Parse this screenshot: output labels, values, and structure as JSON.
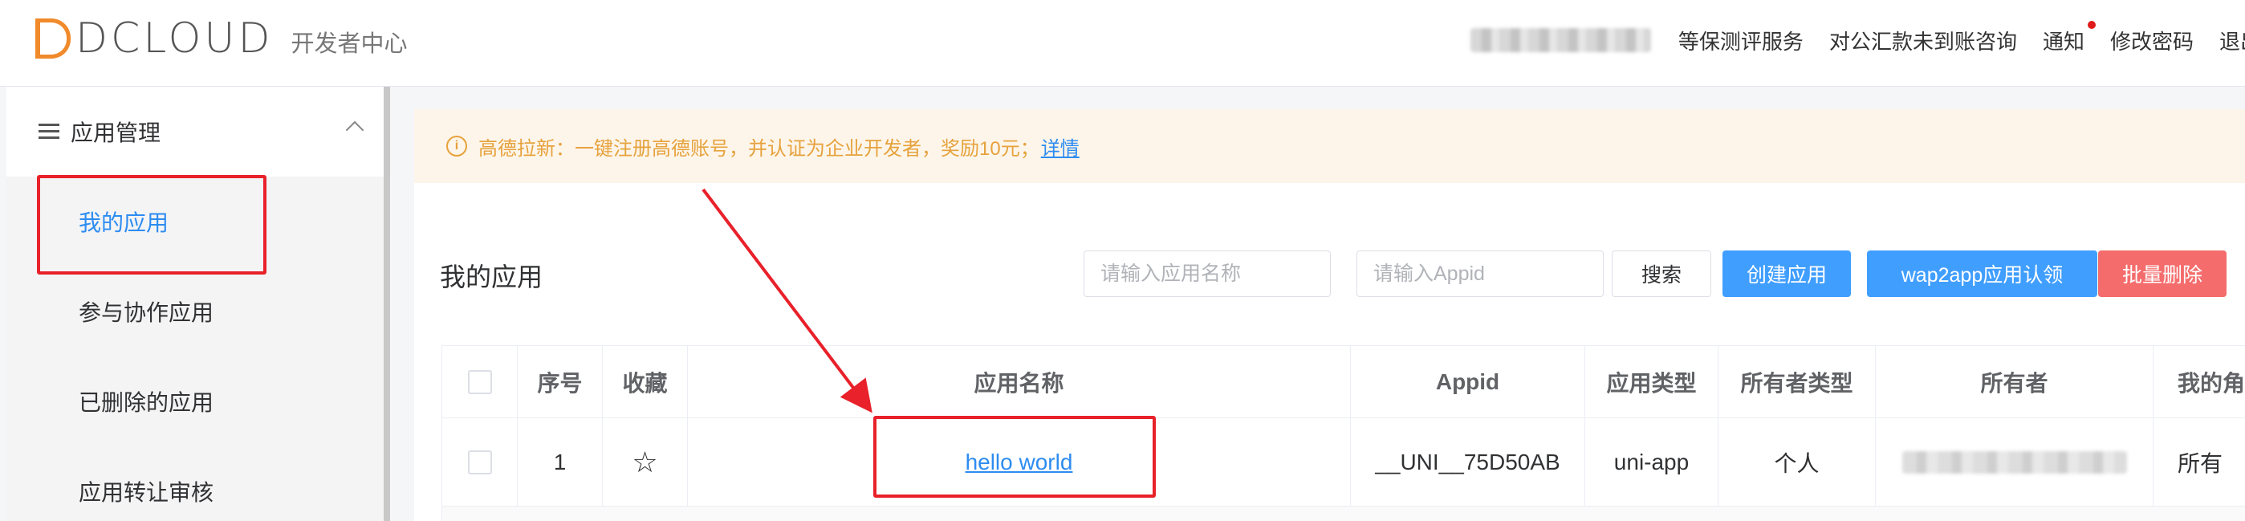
{
  "header": {
    "logo_text": "DCLOUD",
    "logo_sub": "开发者中心",
    "nav": [
      "等保测评服务",
      "对公汇款未到账咨询",
      "通知",
      "修改密码",
      "退出"
    ]
  },
  "sidebar": {
    "group_label": "应用管理",
    "items": [
      {
        "label": "我的应用",
        "active": true
      },
      {
        "label": "参与协作应用"
      },
      {
        "label": "已删除的应用"
      },
      {
        "label": "应用转让审核"
      }
    ]
  },
  "notice": {
    "text": "高德拉新：一键注册高德账号，并认证为企业开发者，奖励10元；",
    "link": "详情"
  },
  "toolbar": {
    "title": "我的应用",
    "name_placeholder": "请输入应用名称",
    "appid_placeholder": "请输入Appid",
    "search_label": "搜索",
    "create_label": "创建应用",
    "wap_label": "wap2app应用认领",
    "delete_label": "批量删除"
  },
  "table": {
    "headers": {
      "no": "序号",
      "fav": "收藏",
      "name": "应用名称",
      "appid": "Appid",
      "type": "应用类型",
      "owner_type": "所有者类型",
      "owner": "所有者",
      "my_role": "我的角"
    },
    "rows": [
      {
        "no": "1",
        "name": "hello world",
        "appid": "__UNI__75D50AB",
        "type": "uni-app",
        "owner_type": "个人",
        "my_role": "所有"
      }
    ]
  },
  "colors": {
    "primary": "#409eff",
    "danger": "#f56c6c",
    "warning": "#e6a23c",
    "link": "#2d8cf0",
    "annotation": "#e8212a"
  }
}
